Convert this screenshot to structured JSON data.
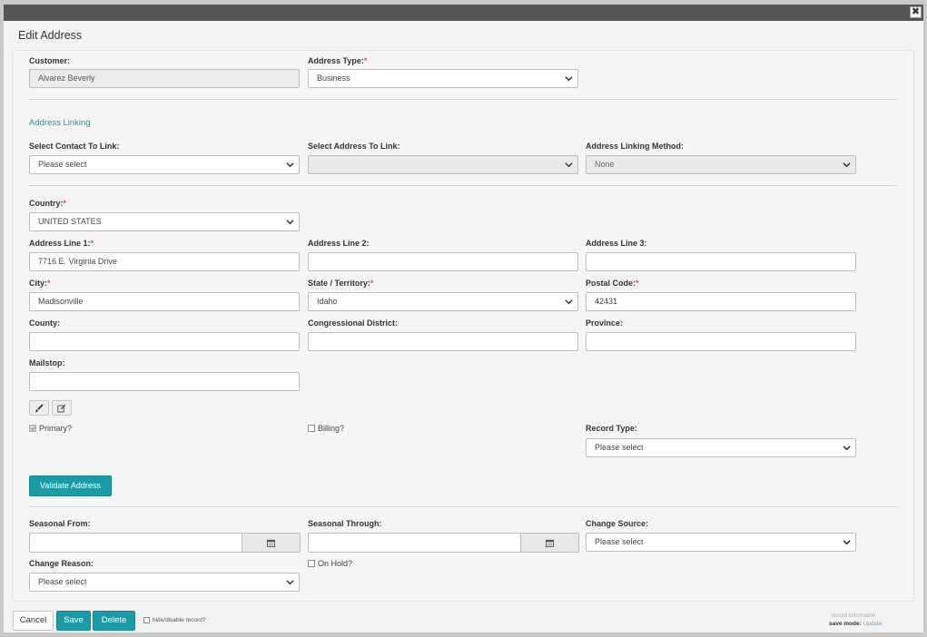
{
  "dialog": {
    "title": "Edit Address",
    "close_glyph": "✖"
  },
  "customer": {
    "label": "Customer:",
    "value": "Alvarez Beverly"
  },
  "address_type": {
    "label": "Address Type:",
    "value": "Business"
  },
  "linking": {
    "section_title": "Address Linking",
    "contact_label": "Select Contact To Link:",
    "contact_value": "Please select",
    "address_label": "Select Address To Link:",
    "address_value": "",
    "method_label": "Address Linking Method:",
    "method_value": "None"
  },
  "country": {
    "label": "Country:",
    "value": "UNITED STATES"
  },
  "address_line1": {
    "label": "Address Line 1:",
    "value": "7716 E. Virginia Drive"
  },
  "address_line2": {
    "label": "Address Line 2:",
    "value": ""
  },
  "address_line3": {
    "label": "Address Line 3:",
    "value": ""
  },
  "city": {
    "label": "City:",
    "value": "Madisonville"
  },
  "state": {
    "label": "State / Territory:",
    "value": "Idaho"
  },
  "postal": {
    "label": "Postal Code:",
    "value": "42431"
  },
  "county": {
    "label": "County:",
    "value": ""
  },
  "congressional": {
    "label": "Congressional District:",
    "value": ""
  },
  "province": {
    "label": "Province:",
    "value": ""
  },
  "mailstop": {
    "label": "Mailstop:",
    "value": ""
  },
  "tools": {
    "brush_icon": "brush-icon",
    "edit_icon": "edit-icon"
  },
  "primary": {
    "label": "Primary?",
    "checked": true
  },
  "billing": {
    "label": "Billing?",
    "checked": false
  },
  "record_type": {
    "label": "Record Type:",
    "value": "Please select"
  },
  "validate_button": "Validate Address",
  "seasonal_from": {
    "label": "Seasonal From:",
    "value": ""
  },
  "seasonal_through": {
    "label": "Seasonal Through:",
    "value": ""
  },
  "change_source": {
    "label": "Change Source:",
    "value": "Please select"
  },
  "change_reason": {
    "label": "Change Reason:",
    "value": "Please select"
  },
  "on_hold": {
    "label": "On Hold?",
    "checked": false
  },
  "footer": {
    "cancel": "Cancel",
    "save": "Save",
    "delete": "Delete",
    "hide_label": "hide/disable record?",
    "record_info": "record information",
    "save_mode_label": "save mode:",
    "save_mode_value": "Update"
  },
  "colors": {
    "accent": "#1e9aa6",
    "required": "#d9534f",
    "link": "#2a8f9a",
    "topbar": "#555555"
  }
}
